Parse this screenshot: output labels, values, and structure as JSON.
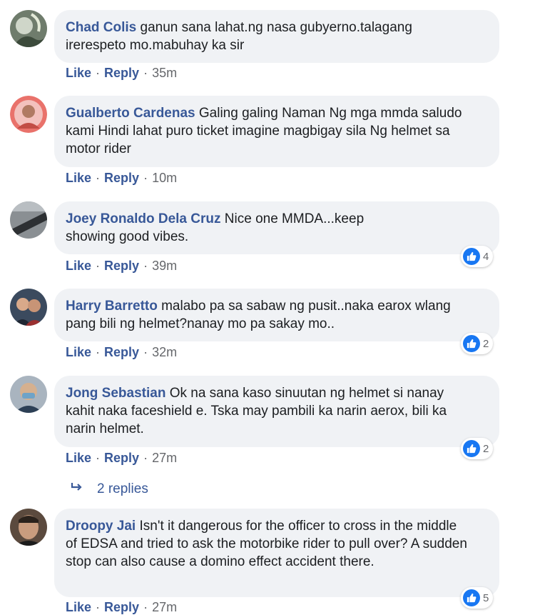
{
  "ui": {
    "like_label": "Like",
    "reply_label": "Reply",
    "dot": "·"
  },
  "comments": [
    {
      "author": "Chad Colis",
      "text": "ganun sana lahat.ng nasa gubyerno.talagang irerespeto mo.mabuhay ka sir",
      "time": "35m",
      "reactions": null
    },
    {
      "author": "Gualberto Cardenas",
      "text": "Galing galing Naman Ng mga mmda saludo kami Hindi lahat puro ticket imagine magbigay sila Ng helmet sa motor rider",
      "time": "10m",
      "reactions": null
    },
    {
      "author": "Joey Ronaldo Dela Cruz",
      "text": "Nice one MMDA...keep showing good vibes.",
      "time": "39m",
      "reactions": "4"
    },
    {
      "author": "Harry Barretto",
      "text": "malabo pa sa sabaw ng pusit..naka earox wlang pang bili ng helmet?nanay mo pa sakay mo..",
      "time": "32m",
      "reactions": "2"
    },
    {
      "author": "Jong Sebastian",
      "text": "Ok na sana kaso sinuutan ng helmet si nanay kahit naka faceshield e. Tska may pambili ka narin aerox, bili ka narin helmet.",
      "time": "27m",
      "reactions": "2"
    },
    {
      "author": "Droopy Jai",
      "text": "Isn't it dangerous for the officer to cross in the middle of EDSA and tried to ask the motorbike rider to pull over? A sudden stop can also cause a domino effect accident there.",
      "time": "27m",
      "reactions": "5"
    }
  ],
  "replies_link": {
    "label": "2 replies"
  }
}
